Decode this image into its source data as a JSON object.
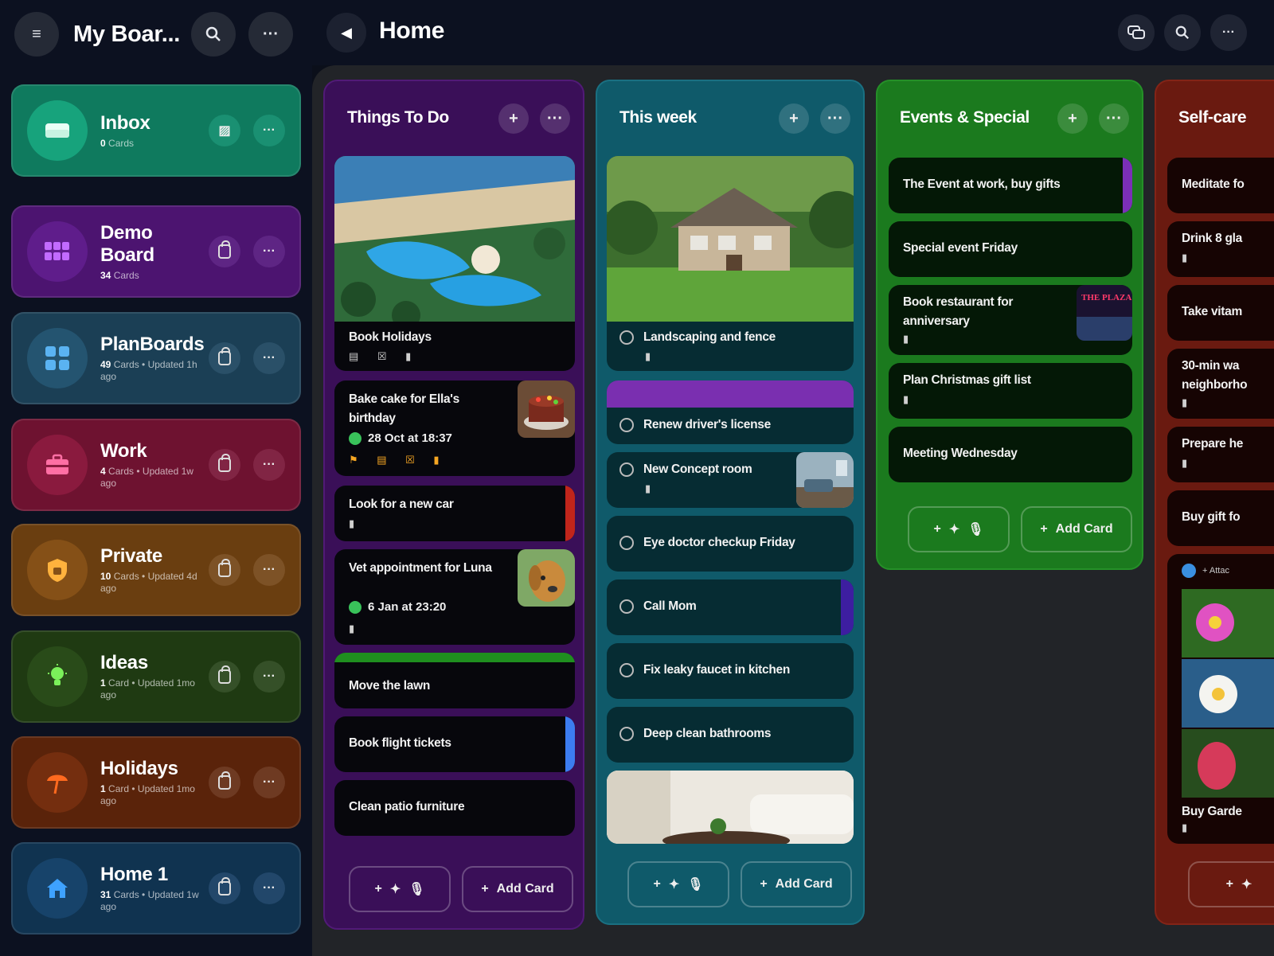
{
  "sidebar": {
    "title": "My Boar...",
    "menu_icon": "menu-icon",
    "search_icon": "search-icon",
    "more_icon": "more-icon",
    "boards": [
      {
        "name": "Inbox",
        "count": "0",
        "meta": "Cards",
        "color": "#0f7a5e",
        "icon_color": "#139a76",
        "icon": "inbox-icon",
        "glyph": "▭",
        "action_icon": "archive-icon"
      },
      {
        "name": "Demo Board",
        "count": "34",
        "meta": "Cards",
        "color": "#4c1470",
        "icon_color": "#5e1c88",
        "icon": "grid-icon",
        "glyph": "▦",
        "action_icon": "lock-icon"
      },
      {
        "name": "PlanBoards",
        "count": "49",
        "meta": "Cards • Updated 1h ago",
        "color": "#1b3f55",
        "icon_color": "#234f6b",
        "icon": "boards-icon",
        "glyph": "▣",
        "action_icon": "lock-icon"
      },
      {
        "name": "Work",
        "count": "4",
        "meta": "Cards • Updated 1w ago",
        "color": "#6e1230",
        "icon_color": "#88183c",
        "icon": "briefcase-icon",
        "glyph": "▬",
        "action_icon": "lock-icon"
      },
      {
        "name": "Private",
        "count": "10",
        "meta": "Cards • Updated 4d ago",
        "color": "#6a3e10",
        "icon_color": "#844f16",
        "icon": "shield-icon",
        "glyph": "⛉",
        "action_icon": "lock-icon"
      },
      {
        "name": "Ideas",
        "count": "1",
        "meta": "Card • Updated 1mo ago",
        "color": "#1f3a12",
        "icon_color": "#284a17",
        "icon": "lightbulb-icon",
        "glyph": "✱",
        "action_icon": "lock-icon"
      },
      {
        "name": "Holidays",
        "count": "1",
        "meta": "Card • Updated 1mo ago",
        "color": "#5a230a",
        "icon_color": "#722d0e",
        "icon": "umbrella-icon",
        "glyph": "☂",
        "action_icon": "lock-icon"
      },
      {
        "name": "Home 1",
        "count": "31",
        "meta": "Cards • Updated 1w ago",
        "color": "#103350",
        "icon_color": "#174266",
        "icon": "house-icon",
        "glyph": "⌂",
        "action_icon": "lock-icon"
      }
    ]
  },
  "header": {
    "title": "Home",
    "back_icon": "back-arrow-icon",
    "icons": [
      "chat-icon",
      "search-icon",
      "more-icon"
    ]
  },
  "columns": [
    {
      "title": "Things To Do",
      "color": "#3a0f58",
      "cards": [
        {
          "title": "Book Holidays",
          "has_image": true,
          "image": "resort-pool-image",
          "icons": "▤ ☒ ▮"
        },
        {
          "title": "Bake cake for Ella's birthday",
          "date": "28 Oct at 18:37",
          "icons": "⚑ ▤ ☒ ▮",
          "thumb": "cake-image"
        },
        {
          "title": "Look for a new car",
          "icons": "▮",
          "accent": "#c0251b"
        },
        {
          "title": "Vet appointment for Luna",
          "date": "6 Jan at 23:20",
          "icons": "▮",
          "thumb": "dog-image"
        },
        {
          "title": "Move the lawn",
          "top_bar": "#1f8f1f"
        },
        {
          "title": "Book flight tickets",
          "accent": "#3c7cf0"
        },
        {
          "title": "Clean patio furniture"
        }
      ],
      "footer": {
        "quick_add": "+",
        "add_card": "Add Card"
      }
    },
    {
      "title": "This week",
      "color": "#0f5a6a",
      "cards": [
        {
          "title": "Landscaping and fence",
          "has_image": true,
          "image": "house-image",
          "icons": "▮"
        },
        {
          "title": "Renew driver's license",
          "top_bar": "#7a2fb0"
        },
        {
          "title": "New Concept room",
          "icons": "▮",
          "thumb": "room-image"
        },
        {
          "title": "Eye doctor checkup Friday"
        },
        {
          "title": "Call Mom",
          "accent": "#3d1ea0"
        },
        {
          "title": "Fix leaky faucet in kitchen"
        },
        {
          "title": "Deep clean bathrooms"
        }
      ],
      "footer": {
        "quick_add": "+",
        "add_card": "Add Card"
      }
    },
    {
      "title": "Events & Special",
      "color": "#1b7a1e",
      "cards": [
        {
          "title": "The Event at work, buy gifts",
          "accent": "#7b2fb8"
        },
        {
          "title": "Special event Friday"
        },
        {
          "title": "Book restaurant for anniversary",
          "icons": "▮",
          "thumb": "restaurant-sign-image",
          "thumb_text": "THE PLAZA"
        },
        {
          "title": "Plan Christmas gift list",
          "icons": "▮"
        },
        {
          "title": "Meeting Wednesday"
        }
      ],
      "footer": {
        "quick_add": "+",
        "add_card": "Add Card"
      }
    },
    {
      "title": "Self-care",
      "color": "#6a1a10",
      "cards": [
        {
          "title": "Meditate fo"
        },
        {
          "title": "Drink 8 gla",
          "icons": "▮"
        },
        {
          "title": "Take vitam"
        },
        {
          "title": "30-min wa neighborho",
          "icons": "▮"
        },
        {
          "title": "Prepare he",
          "icons": "▮"
        },
        {
          "title": "Buy gift fo"
        },
        {
          "title": "Buy Garde",
          "icons": "▮",
          "attach": "+ Attac"
        }
      ],
      "footer": {
        "quick_add": "+"
      }
    }
  ]
}
